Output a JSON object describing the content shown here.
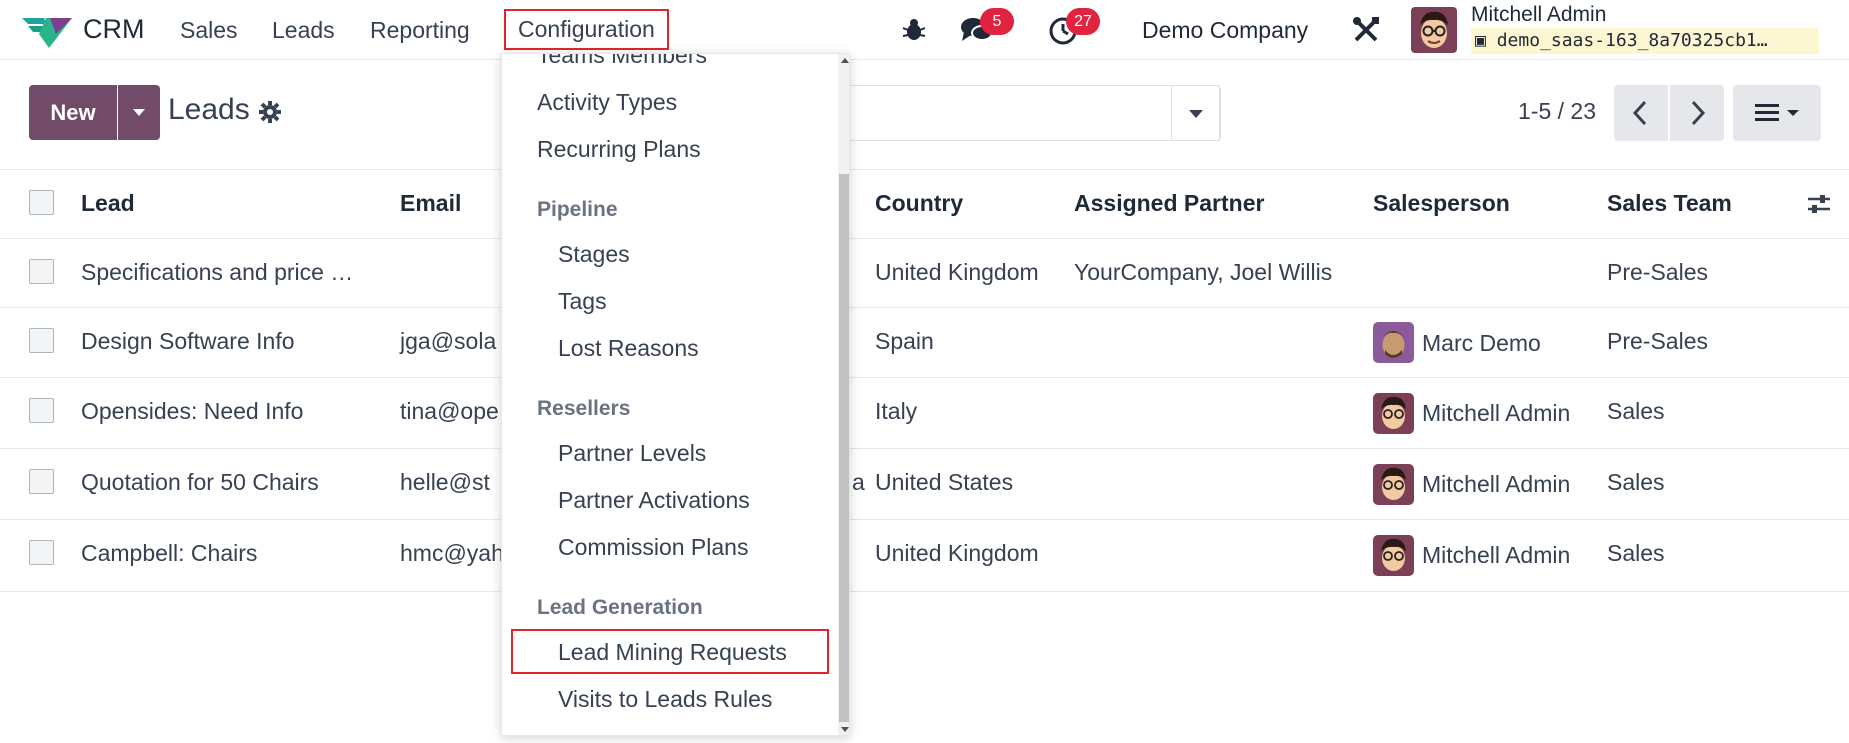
{
  "navbar": {
    "app_name": "CRM",
    "menus": [
      "Sales",
      "Leads",
      "Reporting",
      "Configuration"
    ],
    "messages_count": "5",
    "activities_count": "27",
    "company": "Demo Company",
    "user_name": "Mitchell Admin",
    "database": "demo_saas-163_8a70325cb1…"
  },
  "control_panel": {
    "new_label": "New",
    "title": "Leads",
    "pager": "1-5 / 23"
  },
  "table": {
    "headers": {
      "lead": "Lead",
      "email": "Email",
      "country": "Country",
      "assigned_partner": "Assigned Partner",
      "salesperson": "Salesperson",
      "sales_team": "Sales Team"
    },
    "rows": [
      {
        "lead": "Specifications and price …",
        "email": "",
        "email_tail": "",
        "country": "United Kingdom",
        "partner": "YourCompany, Joel Willis",
        "salesperson": "",
        "team": "Pre-Sales"
      },
      {
        "lead": "Design Software Info",
        "email": "jga@sola",
        "email_tail": "",
        "country": "Spain",
        "partner": "",
        "salesperson": "Marc Demo",
        "team": "Pre-Sales"
      },
      {
        "lead": "Opensides: Need Info",
        "email": "tina@ope",
        "email_tail": "",
        "country": "Italy",
        "partner": "",
        "salesperson": "Mitchell Admin",
        "team": "Sales"
      },
      {
        "lead": "Quotation for 50 Chairs",
        "email": "helle@st",
        "email_tail": "a",
        "country": "United States",
        "partner": "",
        "salesperson": "Mitchell Admin",
        "team": "Sales"
      },
      {
        "lead": "Campbell: Chairs",
        "email": "hmc@yah",
        "email_tail": "",
        "country": "United Kingdom",
        "partner": "",
        "salesperson": "Mitchell Admin",
        "team": "Sales"
      }
    ]
  },
  "dropdown": {
    "partial_top": "Teams Members",
    "activity_types": "Activity Types",
    "recurring_plans": "Recurring Plans",
    "pipeline_header": "Pipeline",
    "stages": "Stages",
    "tags": "Tags",
    "lost_reasons": "Lost Reasons",
    "resellers_header": "Resellers",
    "partner_levels": "Partner Levels",
    "partner_activations": "Partner Activations",
    "commission_plans": "Commission Plans",
    "lead_generation_header": "Lead Generation",
    "lead_mining_requests": "Lead Mining Requests",
    "visits_to_leads_rules": "Visits to Leads Rules"
  },
  "colors": {
    "brand": "#714b67",
    "badge": "#e0243f",
    "highlight": "#e0242c"
  }
}
